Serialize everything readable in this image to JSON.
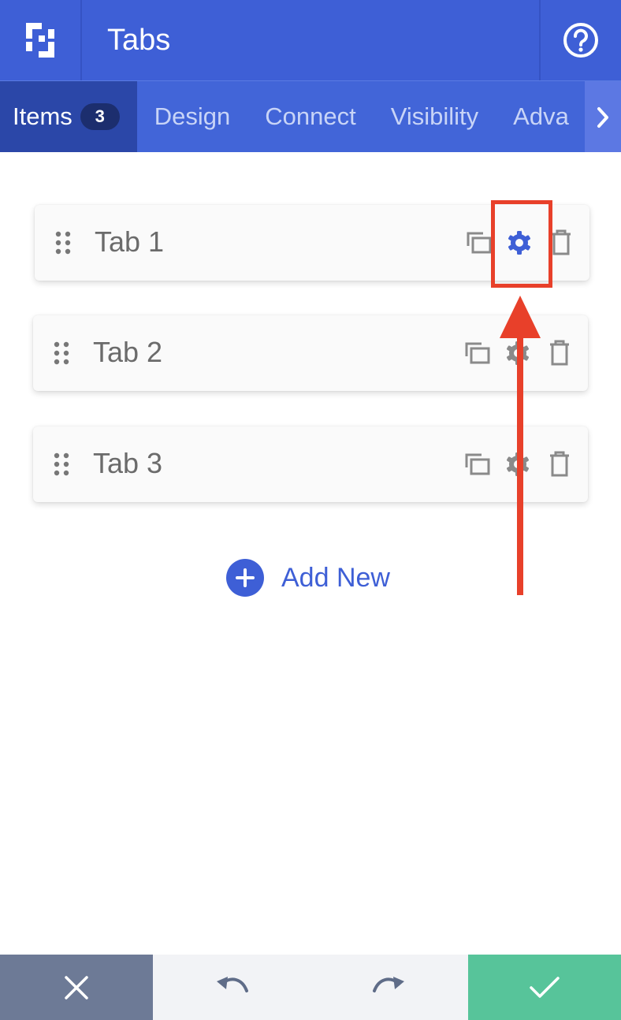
{
  "header": {
    "title": "Tabs",
    "logo_icon": "builder-logo-icon",
    "help_icon": "help-circle-icon"
  },
  "tabs": [
    {
      "label": "Items",
      "badge": "3",
      "active": true
    },
    {
      "label": "Design",
      "active": false
    },
    {
      "label": "Connect",
      "active": false
    },
    {
      "label": "Visibility",
      "active": false
    },
    {
      "label": "Adva",
      "active": false
    }
  ],
  "items": [
    {
      "label": "Tab 1"
    },
    {
      "label": "Tab 2"
    },
    {
      "label": "Tab 3"
    }
  ],
  "add_new": {
    "label": "Add New"
  },
  "colors": {
    "brand": "#3e5fd6",
    "active_tab": "#2b47a8",
    "annotation": "#e8402a",
    "cancel": "#6d7a96",
    "confirm": "#57c49a"
  },
  "footer": {
    "cancel_icon": "close-icon",
    "undo_icon": "undo-icon",
    "redo_icon": "redo-icon",
    "confirm_icon": "check-icon"
  }
}
